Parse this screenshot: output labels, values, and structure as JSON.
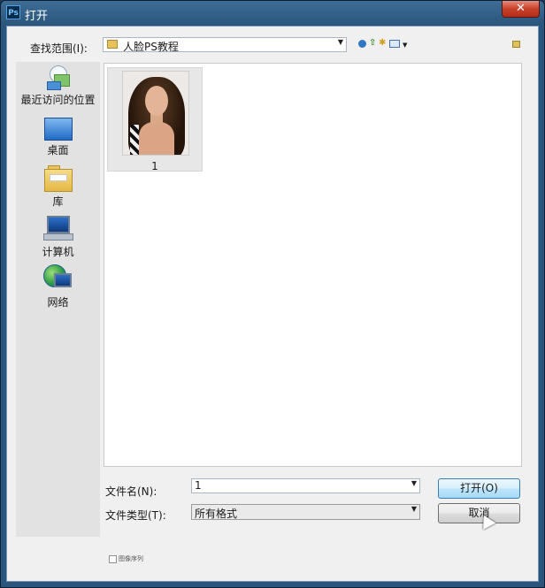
{
  "window": {
    "app_icon_text": "Ps",
    "title": "打开",
    "close_glyph": "✕"
  },
  "toolbar": {
    "lookin_label": "查找范围(I):",
    "lookin_value": "人脸PS教程",
    "icons": [
      "back-icon",
      "up-folder-icon",
      "new-folder-icon",
      "view-menu-icon"
    ]
  },
  "places": [
    {
      "label": "最近访问的位置",
      "icon": "recent-places-icon"
    },
    {
      "label": "桌面",
      "icon": "desktop-icon"
    },
    {
      "label": "库",
      "icon": "libraries-icon"
    },
    {
      "label": "计算机",
      "icon": "computer-icon"
    },
    {
      "label": "网络",
      "icon": "network-icon"
    }
  ],
  "files": [
    {
      "name": "1",
      "thumbnail": "portrait-photo"
    }
  ],
  "filename": {
    "label": "文件名(N):",
    "value": "1"
  },
  "filetype": {
    "label": "文件类型(T):",
    "value": "所有格式"
  },
  "buttons": {
    "open": "打开(O)",
    "cancel": "取消"
  },
  "image_sequence": {
    "label": "图像序列",
    "checked": false
  },
  "colors": {
    "title_bar": "#2a557c",
    "close_button": "#c7412a",
    "open_button_highlight": "#bee6fd",
    "dialog_background": "#f0f0f0"
  }
}
